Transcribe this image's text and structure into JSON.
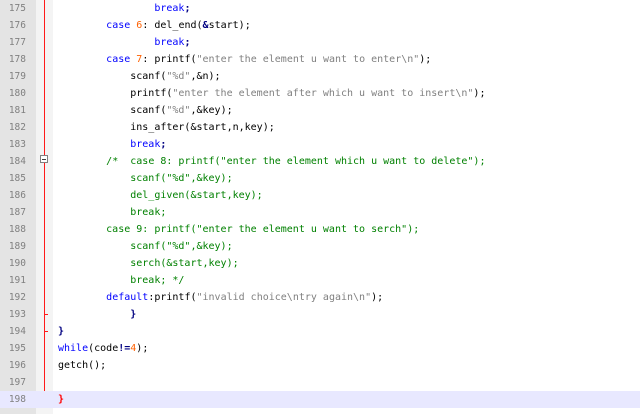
{
  "editor": {
    "lines": [
      {
        "n": "175",
        "code": [
          {
            "t": "                "
          },
          {
            "t": "break",
            "c": "kw"
          },
          {
            "t": ";",
            "c": "op"
          }
        ]
      },
      {
        "n": "176",
        "code": [
          {
            "t": "        "
          },
          {
            "t": "case",
            "c": "kw"
          },
          {
            "t": " "
          },
          {
            "t": "6",
            "c": "num"
          },
          {
            "t": ": del_end("
          },
          {
            "t": "&",
            "c": "op"
          },
          {
            "t": "start);"
          }
        ]
      },
      {
        "n": "177",
        "code": [
          {
            "t": "                "
          },
          {
            "t": "break",
            "c": "kw"
          },
          {
            "t": ";",
            "c": "op"
          }
        ]
      },
      {
        "n": "178",
        "code": [
          {
            "t": "        "
          },
          {
            "t": "case",
            "c": "kw"
          },
          {
            "t": " "
          },
          {
            "t": "7",
            "c": "num"
          },
          {
            "t": ": printf("
          },
          {
            "t": "\"enter the element u want to enter\\n\"",
            "c": "str"
          },
          {
            "t": ");"
          }
        ]
      },
      {
        "n": "179",
        "code": [
          {
            "t": "            scanf("
          },
          {
            "t": "\"%d\"",
            "c": "str"
          },
          {
            "t": ",&n);"
          }
        ]
      },
      {
        "n": "180",
        "code": [
          {
            "t": "            printf("
          },
          {
            "t": "\"enter the element after which u want to insert\\n\"",
            "c": "str"
          },
          {
            "t": ");"
          }
        ]
      },
      {
        "n": "181",
        "code": [
          {
            "t": "            scanf("
          },
          {
            "t": "\"%d\"",
            "c": "str"
          },
          {
            "t": ",&key);"
          }
        ]
      },
      {
        "n": "182",
        "code": [
          {
            "t": "            ins_after(&start,n,key);"
          }
        ]
      },
      {
        "n": "183",
        "code": [
          {
            "t": "            "
          },
          {
            "t": "break",
            "c": "kw"
          },
          {
            "t": ";",
            "c": "op"
          }
        ]
      },
      {
        "n": "184",
        "code": [
          {
            "t": "        "
          },
          {
            "t": "/*  case 8: printf(\"enter the element which u want to delete\");",
            "c": "cmt"
          }
        ]
      },
      {
        "n": "185",
        "code": [
          {
            "t": "            scanf(\"%d\",&key);",
            "c": "cmt"
          }
        ]
      },
      {
        "n": "186",
        "code": [
          {
            "t": "            del_given(&start,key);",
            "c": "cmt"
          }
        ]
      },
      {
        "n": "187",
        "code": [
          {
            "t": "            break;",
            "c": "cmt"
          }
        ]
      },
      {
        "n": "188",
        "code": [
          {
            "t": "        case 9: printf(\"enter the element u want to serch\");",
            "c": "cmt"
          }
        ]
      },
      {
        "n": "189",
        "code": [
          {
            "t": "            scanf(\"%d\",&key);",
            "c": "cmt"
          }
        ]
      },
      {
        "n": "190",
        "code": [
          {
            "t": "            serch(&start,key);",
            "c": "cmt"
          }
        ]
      },
      {
        "n": "191",
        "code": [
          {
            "t": "            break; */",
            "c": "cmt"
          }
        ]
      },
      {
        "n": "192",
        "code": [
          {
            "t": "        "
          },
          {
            "t": "default",
            "c": "kw"
          },
          {
            "t": ":printf("
          },
          {
            "t": "\"invalid choice\\ntry again\\n\"",
            "c": "str"
          },
          {
            "t": ");"
          }
        ]
      },
      {
        "n": "193",
        "code": [
          {
            "t": "            "
          },
          {
            "t": "}",
            "c": "op"
          }
        ]
      },
      {
        "n": "194",
        "code": [
          {
            "t": "}",
            "c": "op"
          }
        ]
      },
      {
        "n": "195",
        "code": [
          {
            "t": "while",
            "c": "kw"
          },
          {
            "t": "(code"
          },
          {
            "t": "!=",
            "c": "op"
          },
          {
            "t": "4",
            "c": "num"
          },
          {
            "t": ");"
          }
        ]
      },
      {
        "n": "196",
        "code": [
          {
            "t": "getch();"
          }
        ]
      },
      {
        "n": "197",
        "code": []
      },
      {
        "n": "198",
        "code": [
          {
            "t": "}",
            "c": "brace-red"
          }
        ],
        "current": true
      }
    ]
  }
}
